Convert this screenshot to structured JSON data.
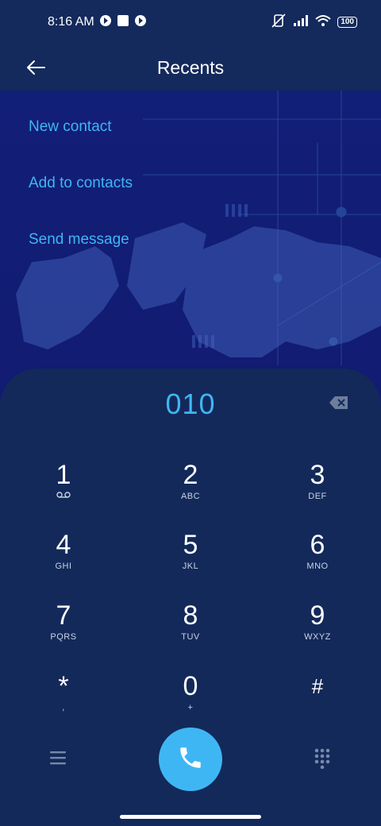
{
  "status_bar": {
    "time": "8:16 AM",
    "battery": "100",
    "icons": [
      "app-notification-icon",
      "square-notification-icon",
      "app-notification-icon",
      "muted-vibrate-icon",
      "signal-icon",
      "wifi-icon",
      "battery-icon"
    ]
  },
  "header": {
    "title": "Recents",
    "back_icon": "back-arrow-icon"
  },
  "actions": [
    {
      "label": "New contact"
    },
    {
      "label": "Add to contacts"
    },
    {
      "label": "Send message"
    }
  ],
  "dialer": {
    "number": "010",
    "backspace_icon": "backspace-icon",
    "keys": [
      {
        "digit": "1",
        "sub": ""
      },
      {
        "digit": "2",
        "sub": "ABC"
      },
      {
        "digit": "3",
        "sub": "DEF"
      },
      {
        "digit": "4",
        "sub": "GHI"
      },
      {
        "digit": "5",
        "sub": "JKL"
      },
      {
        "digit": "6",
        "sub": "MNO"
      },
      {
        "digit": "7",
        "sub": "PQRS"
      },
      {
        "digit": "8",
        "sub": "TUV"
      },
      {
        "digit": "9",
        "sub": "WXYZ"
      },
      {
        "digit": "*",
        "sub": ","
      },
      {
        "digit": "0",
        "sub": "+"
      },
      {
        "digit": "#",
        "sub": ""
      }
    ],
    "menu_icon": "menu-icon",
    "call_icon": "phone-icon",
    "dialpad_icon": "dialpad-icon"
  },
  "colors": {
    "accent": "#3fb6f4",
    "panel": "#13295a",
    "background": "#111c72"
  }
}
